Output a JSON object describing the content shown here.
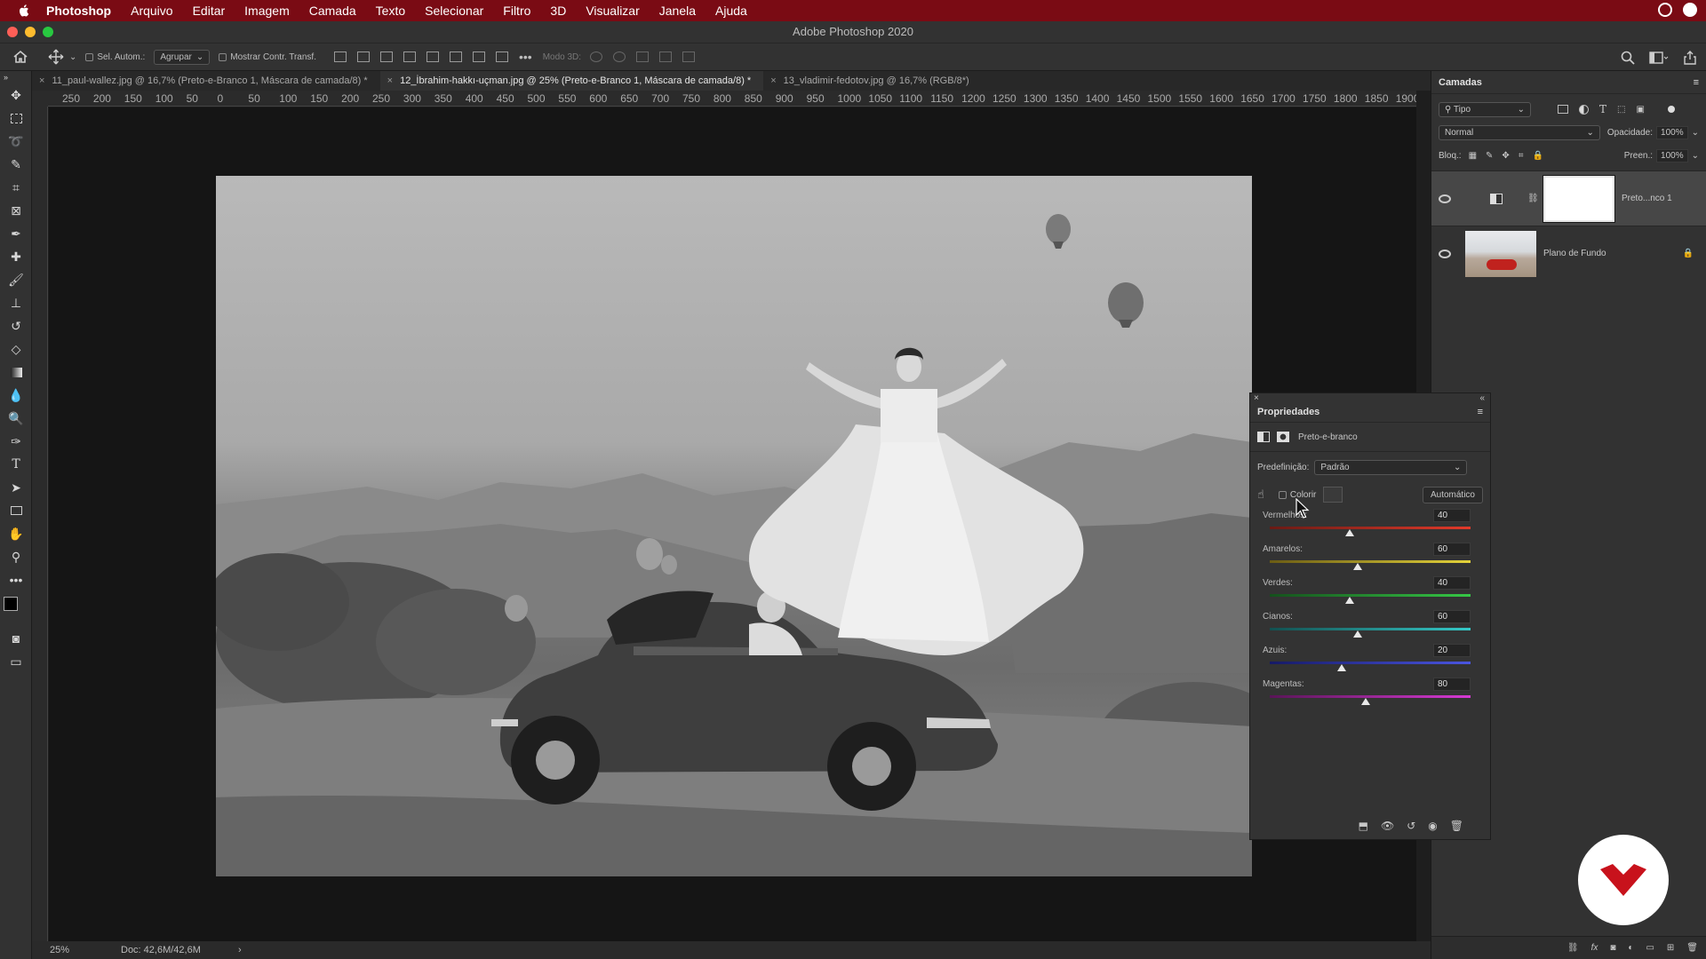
{
  "menubar": {
    "app_name": "Photoshop",
    "items": [
      "Arquivo",
      "Editar",
      "Imagem",
      "Camada",
      "Texto",
      "Selecionar",
      "Filtro",
      "3D",
      "Visualizar",
      "Janela",
      "Ajuda"
    ]
  },
  "window": {
    "title": "Adobe Photoshop 2020"
  },
  "options_bar": {
    "auto_select_label": "Sel. Autom.:",
    "group_value": "Agrupar",
    "show_transform_label": "Mostrar Contr. Transf.",
    "mode3d_label": "Modo 3D:"
  },
  "tabs": [
    {
      "label": "11_paul-wallez.jpg @ 16,7% (Preto-e-Branco 1, Máscara de camada/8) *"
    },
    {
      "label": "12_İbrahim-hakkı-uçman.jpg @ 25% (Preto-e-Branco 1, Máscara de camada/8) *"
    },
    {
      "label": "13_vladimir-fedotov.jpg @ 16,7% (RGB/8*)"
    }
  ],
  "ruler_ticks": [
    "250",
    "200",
    "150",
    "100",
    "50",
    "0",
    "50",
    "100",
    "150",
    "200",
    "250",
    "300",
    "350",
    "400",
    "450",
    "500",
    "550",
    "600",
    "650",
    "700",
    "750",
    "800",
    "850",
    "900",
    "950",
    "1000",
    "1050",
    "1100",
    "1150",
    "1200",
    "1250",
    "1300",
    "1350",
    "1400",
    "1450",
    "1500",
    "1550",
    "1600",
    "1650",
    "1700",
    "1750",
    "1800",
    "1850",
    "1900"
  ],
  "status": {
    "zoom": "25%",
    "doc": "Doc: 42,6M/42,6M"
  },
  "layers_panel": {
    "title": "Camadas",
    "filter_value": "Tipo",
    "blend_mode": "Normal",
    "opacity_label": "Opacidade:",
    "opacity_value": "100%",
    "lock_label": "Bloq.:",
    "fill_label": "Preen.:",
    "fill_value": "100%",
    "layers": [
      {
        "name": "Preto...nco 1"
      },
      {
        "name": "Plano de Fundo"
      }
    ]
  },
  "properties_panel": {
    "title": "Propriedades",
    "adjustment_name": "Preto-e-branco",
    "preset_label": "Predefinição:",
    "preset_value": "Padrão",
    "tint_label": "Colorir",
    "auto_button": "Automático",
    "sliders": [
      {
        "label": "Vermelhos:",
        "value": "40",
        "level": 0.4,
        "gradient": "linear-gradient(to right, #6a1a14, #e23a2a)"
      },
      {
        "label": "Amarelos:",
        "value": "60",
        "level": 0.44,
        "gradient": "linear-gradient(to right, #6b5c14, #e4d33a)"
      },
      {
        "label": "Verdes:",
        "value": "40",
        "level": 0.4,
        "gradient": "linear-gradient(to right, #14501c, #36c846)"
      },
      {
        "label": "Cianos:",
        "value": "60",
        "level": 0.44,
        "gradient": "linear-gradient(to right, #125050, #35c9c8)"
      },
      {
        "label": "Azuis:",
        "value": "20",
        "level": 0.36,
        "gradient": "linear-gradient(to right, #161a66, #4a55e0)"
      },
      {
        "label": "Magentas:",
        "value": "80",
        "level": 0.48,
        "gradient": "linear-gradient(to right, #5a1458, #d73ad4)"
      }
    ]
  },
  "colors": {
    "menubar": "#7a0b14",
    "logo_red": "#c8121c"
  }
}
